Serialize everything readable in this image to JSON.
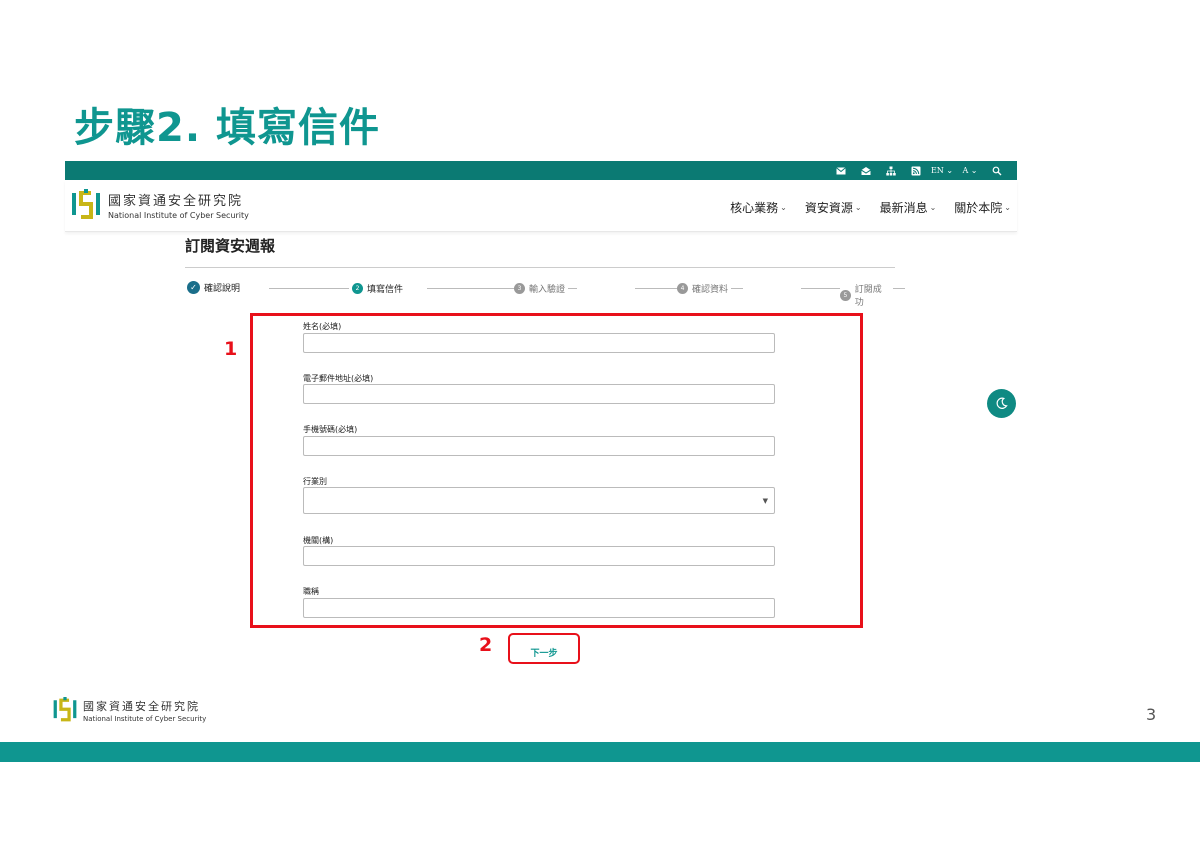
{
  "slide": {
    "title": "步驟2. 填寫信件",
    "page_number": "3",
    "marker_1": "1",
    "marker_2": "2"
  },
  "colors": {
    "brand_teal": "#0f9690",
    "topbar_teal": "#0b7a73",
    "highlight_red": "#e8101a"
  },
  "topbar": {
    "icons": [
      "mail-icon",
      "mail-open-icon",
      "sitemap-icon",
      "rss-icon"
    ],
    "lang": "EN",
    "font": "A",
    "search_icon": "search-icon"
  },
  "site": {
    "name_cn": "國家資通安全研究院",
    "name_en": "National Institute of Cyber Security"
  },
  "nav": {
    "items": [
      {
        "label": "核心業務"
      },
      {
        "label": "資安資源"
      },
      {
        "label": "最新消息"
      },
      {
        "label": "關於本院"
      }
    ]
  },
  "form": {
    "title": "訂閱資安週報",
    "steps": [
      {
        "num": "✓",
        "label": "確認說明",
        "state": "done"
      },
      {
        "num": "2",
        "label": "填寫信件",
        "state": "active"
      },
      {
        "num": "3",
        "label": "輸入驗證",
        "state": "pending"
      },
      {
        "num": "4",
        "label": "確認資料",
        "state": "pending"
      },
      {
        "num": "5",
        "label": "訂閱成功",
        "state": "pending"
      }
    ],
    "fields": [
      {
        "label": "姓名(必填)",
        "value": ""
      },
      {
        "label": "電子郵件地址(必填)",
        "value": ""
      },
      {
        "label": "手機號碼(必填)",
        "value": ""
      },
      {
        "label": "行業別",
        "value": ""
      },
      {
        "label": "機關(構)",
        "value": ""
      },
      {
        "label": "職稱",
        "value": ""
      }
    ],
    "next_label": "下一步"
  }
}
